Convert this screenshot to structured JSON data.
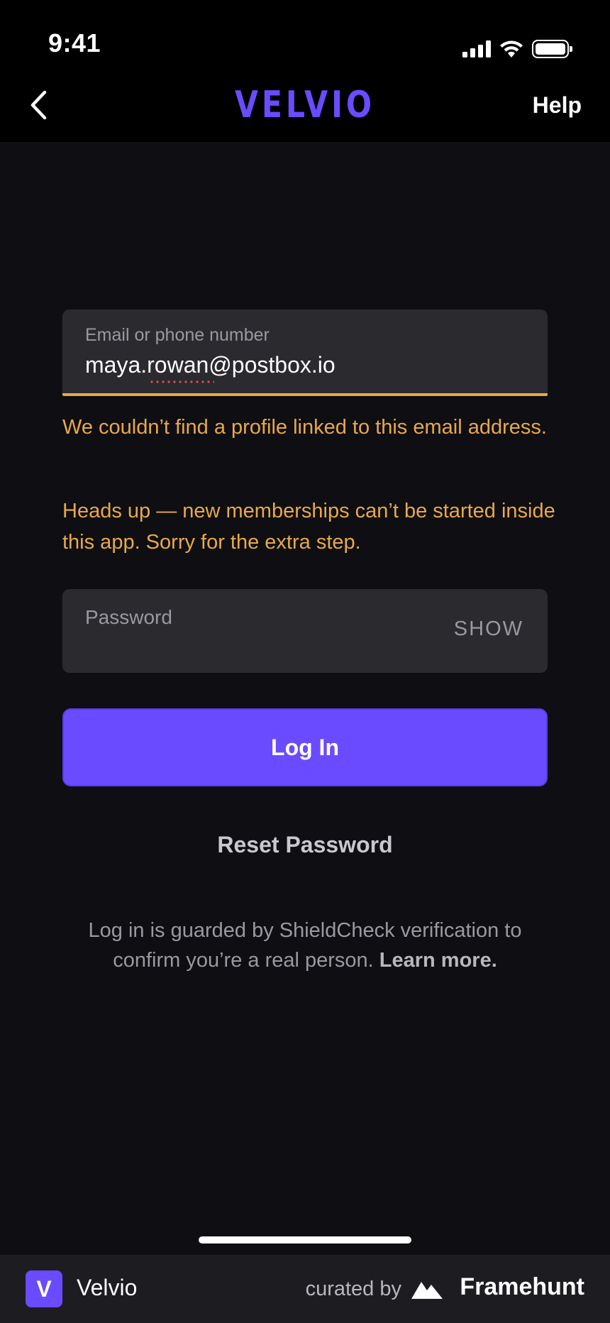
{
  "status_bar": {
    "time": "9:41"
  },
  "nav": {
    "brand": "VELVIO",
    "help": "Help"
  },
  "email": {
    "label": "Email or phone number",
    "value": "maya.rowan@postbox.io"
  },
  "errors": {
    "not_found": "We couldn’t find a profile linked to this email address.",
    "notice": "Heads up — new memberships can’t be started inside this app. Sorry for the extra step."
  },
  "password": {
    "placeholder": "Password",
    "show": "SHOW"
  },
  "actions": {
    "login": "Log In",
    "reset": "Reset Password"
  },
  "guard": {
    "text": "Log in is guarded by ShieldCheck verification to confirm you’re a real person. ",
    "link": "Learn more."
  },
  "footer": {
    "logo_letter": "V",
    "app_name": "Velvio",
    "curated_by": "curated by",
    "brand": "Framehunt"
  },
  "colors": {
    "accent": "#6a4bff",
    "warning": "#e7a94a",
    "background": "#0f0e12",
    "field": "#2b2a2f"
  }
}
